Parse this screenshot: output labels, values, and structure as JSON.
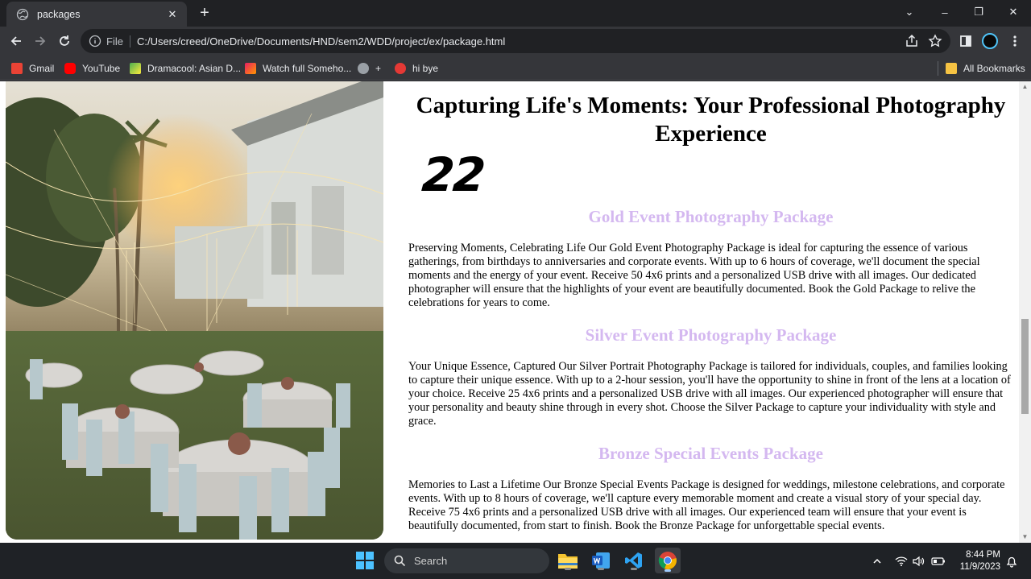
{
  "browser": {
    "tab": {
      "title": "packages",
      "close": "✕"
    },
    "new_tab": "+",
    "window_controls": {
      "minimize": "–",
      "restore": "❐",
      "close": "✕",
      "tablist": "⌄"
    },
    "address": {
      "scheme_label": "File",
      "url": "C:/Users/creed/OneDrive/Documents/HND/sem2/WDD/project/ex/package.html"
    },
    "bookmarks": [
      {
        "label": "Gmail",
        "color": "#ea4335"
      },
      {
        "label": "YouTube",
        "color": "#ff0000"
      },
      {
        "label": "Dramacool: Asian D...",
        "color": "#4caf50"
      },
      {
        "label": "Watch full Someho...",
        "color": "#e91e63"
      },
      {
        "label": "+",
        "color": "#9aa0a6"
      },
      {
        "label": "hi bye",
        "color": "#e53935"
      }
    ],
    "all_bookmarks": "All Bookmarks"
  },
  "page": {
    "title": "Capturing Life's Moments: Your Professional Photography Experience",
    "counter": "22",
    "packages": [
      {
        "title": "Gold Event Photography Package",
        "description": "Preserving Moments, Celebrating Life Our Gold Event Photography Package is ideal for capturing the essence of various gatherings, from birthdays to anniversaries and corporate events. With up to 6 hours of coverage, we'll document the special moments and the energy of your event. Receive 50 4x6 prints and a personalized USB drive with all images. Our dedicated photographer will ensure that the highlights of your event are beautifully documented. Book the Gold Package to relive the celebrations for years to come."
      },
      {
        "title": "Silver Event Photography Package",
        "description": "Your Unique Essence, Captured Our Silver Portrait Photography Package is tailored for individuals, couples, and families looking to capture their unique essence. With up to a 2-hour session, you'll have the opportunity to shine in front of the lens at a location of your choice. Receive 25 4x6 prints and a personalized USB drive with all images. Our experienced photographer will ensure that your personality and beauty shine through in every shot. Choose the Silver Package to capture your individuality with style and grace."
      },
      {
        "title": "Bronze Special Events Package",
        "description": "Memories to Last a Lifetime Our Bronze Special Events Package is designed for weddings, milestone celebrations, and corporate events. With up to 8 hours of coverage, we'll capture every memorable moment and create a visual story of your special day. Receive 75 4x6 prints and a personalized USB drive with all images. Our experienced team will ensure that your event is beautifully documented, from start to finish. Book the Bronze Package for unforgettable special events."
      }
    ],
    "accent_color": "#d4b8f0"
  },
  "taskbar": {
    "search_label": "Search",
    "time": "8:44 PM",
    "date": "11/9/2023"
  }
}
